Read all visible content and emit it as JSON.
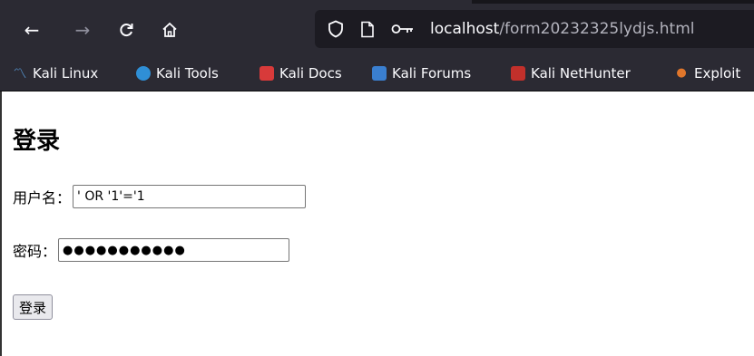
{
  "browser": {
    "nav": {
      "back_icon": "←",
      "forward_icon": "→",
      "reload_icon": "C",
      "home_icon": "⌂"
    },
    "url": {
      "shield_icon": "◯",
      "page_icon": "🗋",
      "key_icon": "⊶",
      "host": "localhost",
      "path": "/form20232325lydjs.html"
    },
    "bookmarks": [
      {
        "label": "Kali Linux",
        "icon": "kali-dragon-icon",
        "color": "#3d7ec2",
        "glyph": "〽"
      },
      {
        "label": "Kali Tools",
        "icon": "kali-tools-icon",
        "color": "#2f8fd6",
        "glyph": "◆"
      },
      {
        "label": "Kali Docs",
        "icon": "kali-docs-icon",
        "color": "#d83a3a",
        "glyph": "▤"
      },
      {
        "label": "Kali Forums",
        "icon": "kali-forums-icon",
        "color": "#3a7fd0",
        "glyph": "✕"
      },
      {
        "label": "Kali NetHunter",
        "icon": "kali-nethunter-icon",
        "color": "#c2302b",
        "glyph": "◣"
      },
      {
        "label": "Exploit",
        "icon": "exploit-db-icon",
        "color": "#e0762b",
        "glyph": "●"
      }
    ]
  },
  "page": {
    "title": "登录",
    "username_label": "用户名：",
    "username_value": "' OR '1'='1",
    "password_label": "密码：",
    "password_value": "●●●●●●●●●●●",
    "submit_label": "登录"
  }
}
